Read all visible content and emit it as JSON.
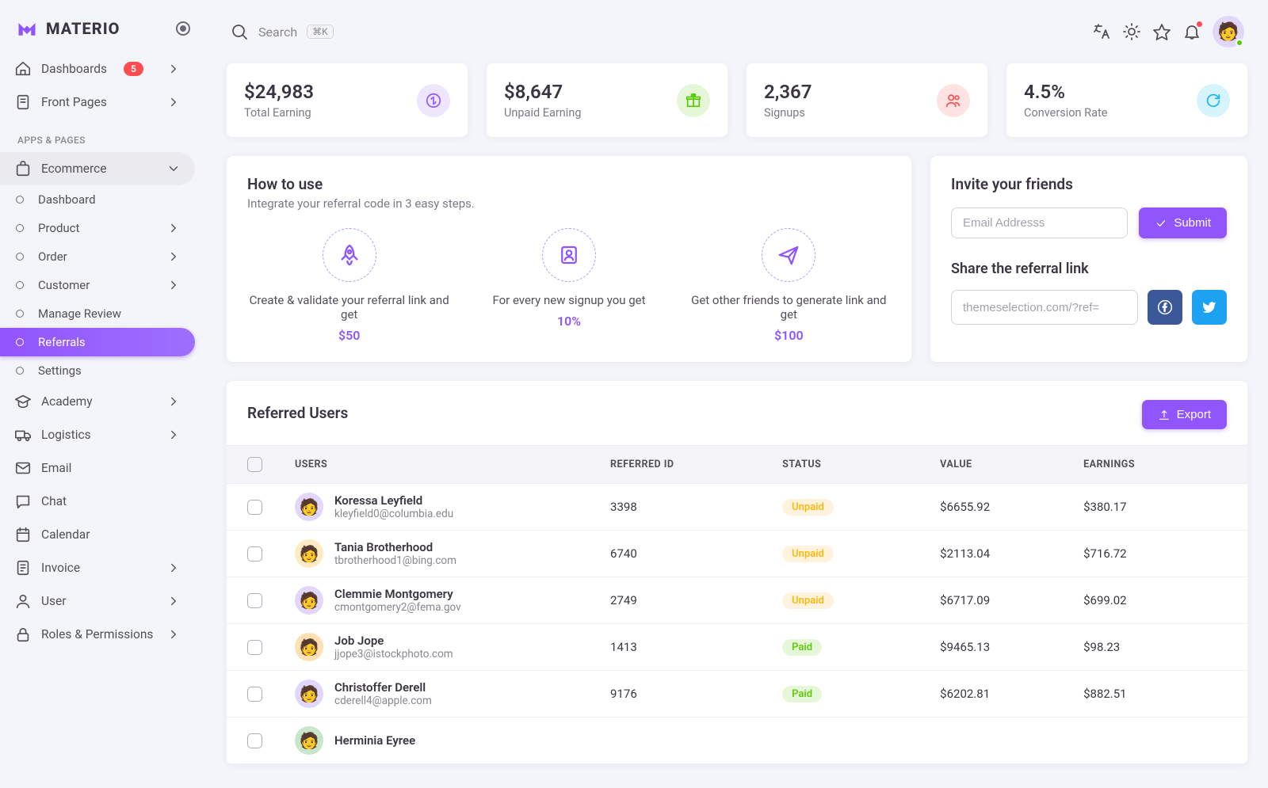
{
  "brand": "MATERIO",
  "search": {
    "placeholder": "Search",
    "shortcut": "⌘K"
  },
  "nav": {
    "dashboards": "Dashboards",
    "dash_badge": "5",
    "frontpages": "Front Pages",
    "section": "APPS & PAGES",
    "ecommerce": "Ecommerce",
    "ec_sub": {
      "dashboard": "Dashboard",
      "product": "Product",
      "order": "Order",
      "customer": "Customer",
      "manage_review": "Manage Review",
      "referrals": "Referrals",
      "settings": "Settings"
    },
    "academy": "Academy",
    "logistics": "Logistics",
    "email": "Email",
    "chat": "Chat",
    "calendar": "Calendar",
    "invoice": "Invoice",
    "user": "User",
    "roles": "Roles & Permissions"
  },
  "stats": [
    {
      "value": "$24,983",
      "label": "Total Earning"
    },
    {
      "value": "$8,647",
      "label": "Unpaid Earning"
    },
    {
      "value": "2,367",
      "label": "Signups"
    },
    {
      "value": "4.5%",
      "label": "Conversion Rate"
    }
  ],
  "howto": {
    "title": "How to use",
    "sub": "Integrate your referral code in 3 easy steps.",
    "steps": [
      {
        "text": "Create & validate your referral link and get",
        "amount": "$50"
      },
      {
        "text": "For every new signup you get",
        "amount": "10%"
      },
      {
        "text": "Get other friends to generate link and get",
        "amount": "$100"
      }
    ]
  },
  "invite": {
    "title": "Invite your friends",
    "email_placeholder": "Email Addresss",
    "submit": "Submit",
    "share_title": "Share the referral link",
    "share_placeholder": "themeselection.com/?ref="
  },
  "users": {
    "title": "Referred Users",
    "export": "Export",
    "cols": {
      "users": "USERS",
      "id": "REFERRED ID",
      "status": "STATUS",
      "value": "VALUE",
      "earn": "EARNINGS"
    },
    "rows": [
      {
        "name": "Koressa Leyfield",
        "email": "kleyfield0@columbia.edu",
        "id": "3398",
        "status": "Unpaid",
        "value": "$6655.92",
        "earn": "$380.17",
        "bg": "#e0d7fb"
      },
      {
        "name": "Tania Brotherhood",
        "email": "tbrotherhood1@bing.com",
        "id": "6740",
        "status": "Unpaid",
        "value": "$2113.04",
        "earn": "$716.72",
        "bg": "#ffeac2"
      },
      {
        "name": "Clemmie Montgomery",
        "email": "cmontgomery2@fema.gov",
        "id": "2749",
        "status": "Unpaid",
        "value": "$6717.09",
        "earn": "$699.02",
        "bg": "#e0d7fb"
      },
      {
        "name": "Job Jope",
        "email": "jjope3@istockphoto.com",
        "id": "1413",
        "status": "Paid",
        "value": "$9465.13",
        "earn": "$98.23",
        "bg": "#ffe0b2"
      },
      {
        "name": "Christoffer Derell",
        "email": "cderell4@apple.com",
        "id": "9176",
        "status": "Paid",
        "value": "$6202.81",
        "earn": "$882.51",
        "bg": "#e0d7fb"
      },
      {
        "name": "Herminia Eyree",
        "email": "",
        "id": "",
        "status": "",
        "value": "",
        "earn": "",
        "bg": "#c8e6c9"
      }
    ]
  }
}
